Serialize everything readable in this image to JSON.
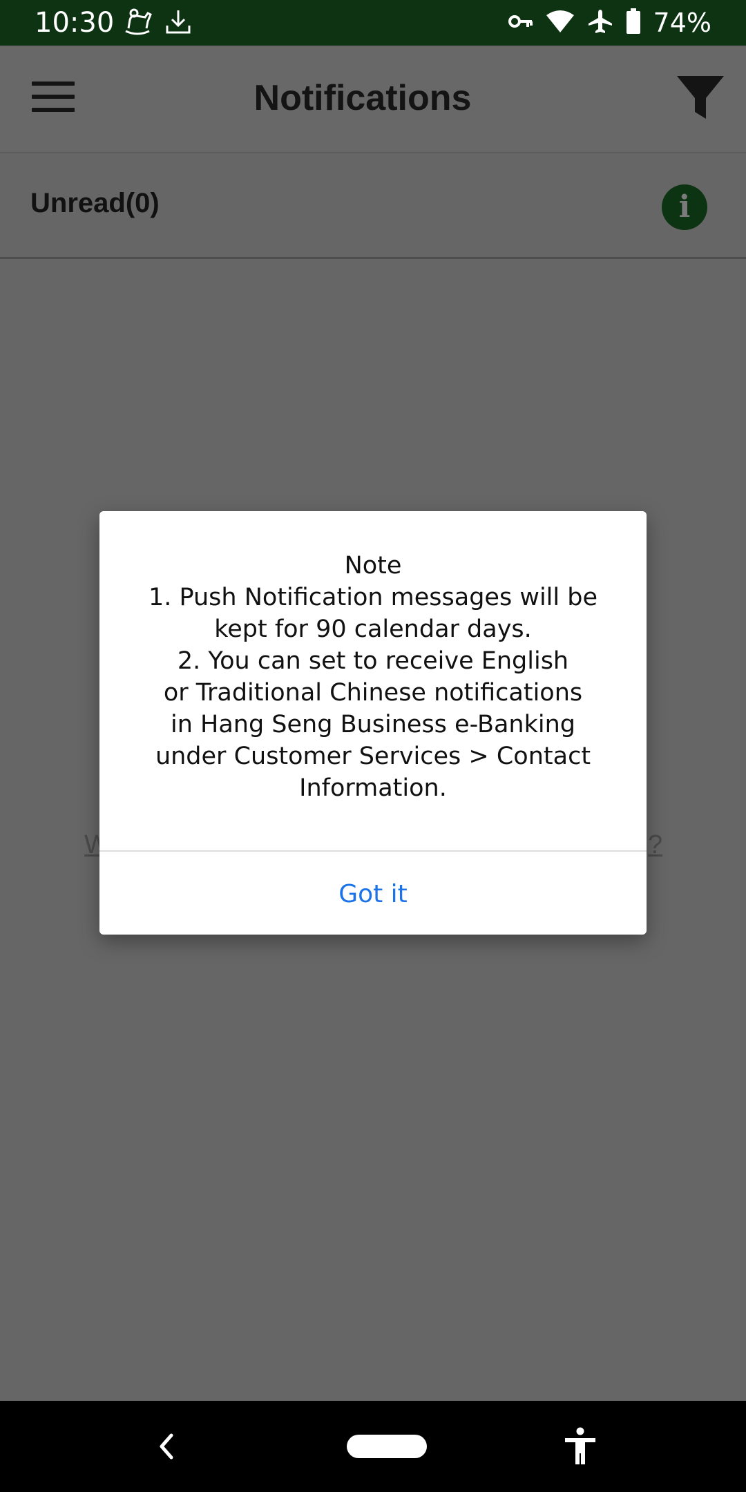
{
  "status_bar": {
    "time": "10:30",
    "battery": "74%",
    "icons_left": [
      "rocking-horse-icon",
      "download-icon"
    ],
    "icons_right": [
      "vpn-key-icon",
      "wifi-icon",
      "airplane-icon",
      "battery-icon"
    ]
  },
  "app_bar": {
    "title": "Notifications",
    "menu_icon": "hamburger-menu-icon",
    "filter_icon": "filter-icon"
  },
  "unread": {
    "label": "Unread(0)",
    "info_icon": "info-icon"
  },
  "background_hint": {
    "left_fragment": "W",
    "right_fragment": "?"
  },
  "dialog": {
    "title": "Note",
    "lines": [
      "1. Push Notification messages will be",
      "kept for 90 calendar days.",
      "2. You can set to receive English",
      "or Traditional Chinese notifications",
      "in Hang Seng Business e-Banking",
      "under Customer Services > Contact",
      "Information."
    ],
    "action_label": "Got it"
  },
  "nav_bar": {
    "back_icon": "back-chevron-icon",
    "home_icon": "home-pill-icon",
    "accessibility_icon": "accessibility-icon"
  },
  "colors": {
    "status_bar_bg": "#0d3313",
    "scrim_bg": "#666666",
    "accent": "#1a73e8",
    "info_bg": "#0c3312"
  }
}
